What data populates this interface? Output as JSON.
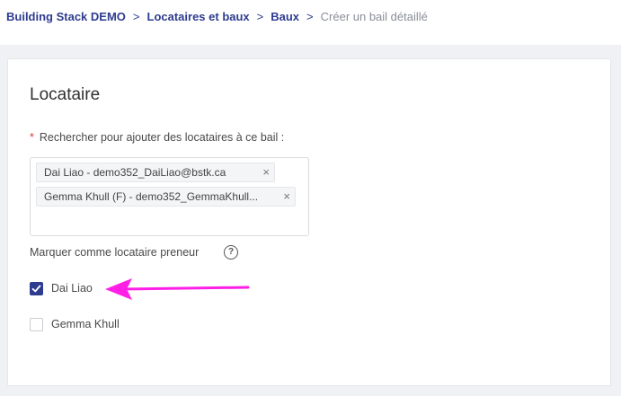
{
  "breadcrumb": {
    "items": [
      "Building Stack DEMO",
      "Locataires et baux",
      "Baux"
    ],
    "separator": ">",
    "current": "Créer un bail détaillé"
  },
  "section": {
    "title": "Locataire"
  },
  "search": {
    "required_mark": "*",
    "label": "Rechercher pour ajouter des locataires à ce bail :",
    "tags": [
      {
        "text": "Dai Liao - demo352_DaiLiao@bstk.ca",
        "remove": "×"
      },
      {
        "text": "Gemma Khull (F) - demo352_GemmaKhull...",
        "remove": "×"
      }
    ]
  },
  "preneur": {
    "label": "Marquer comme locataire preneur",
    "help_icon": "?"
  },
  "tenants": [
    {
      "name": "Dai Liao",
      "checked": true
    },
    {
      "name": "Gemma Khull",
      "checked": false
    }
  ],
  "colors": {
    "accent": "#2e3c8f",
    "annotation_arrow": "#ff1ee6",
    "required": "#e0352f"
  },
  "icons": {
    "tag_remove": "close-icon",
    "help": "question-circle-icon",
    "checkbox": "check-icon",
    "annotation": "arrow-left-icon"
  }
}
